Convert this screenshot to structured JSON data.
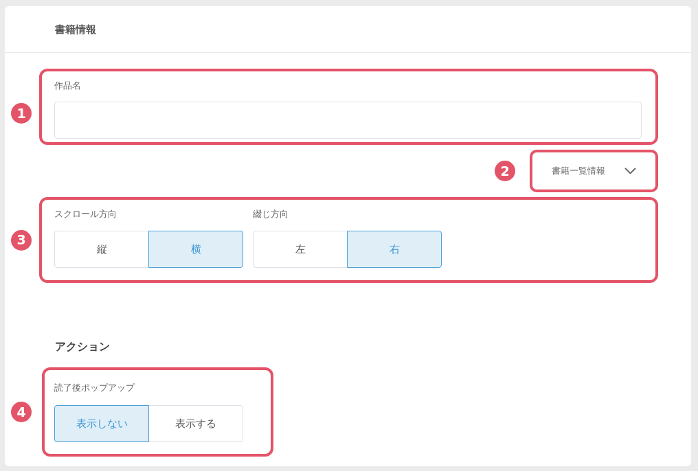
{
  "card": {
    "title": "書籍情報"
  },
  "title_field": {
    "callout": "1",
    "label": "作品名"
  },
  "list_info_toggle": {
    "callout": "2",
    "label": "書籍一覧情報",
    "expanded": false
  },
  "direction_settings": {
    "callout": "3",
    "groups": [
      {
        "label": "スクロール方向",
        "options": [
          {
            "label": "縦",
            "selected": false
          },
          {
            "label": "横",
            "selected": true
          }
        ]
      },
      {
        "label": "綴じ方向",
        "options": [
          {
            "label": "左",
            "selected": false
          },
          {
            "label": "右",
            "selected": true
          }
        ]
      }
    ]
  },
  "action_section": {
    "title": "アクション",
    "popup_setting": {
      "callout": "4",
      "label": "読了後ポップアップ",
      "options": [
        {
          "label": "表示しない",
          "selected": true
        },
        {
          "label": "表示する",
          "selected": false
        }
      ]
    }
  }
}
